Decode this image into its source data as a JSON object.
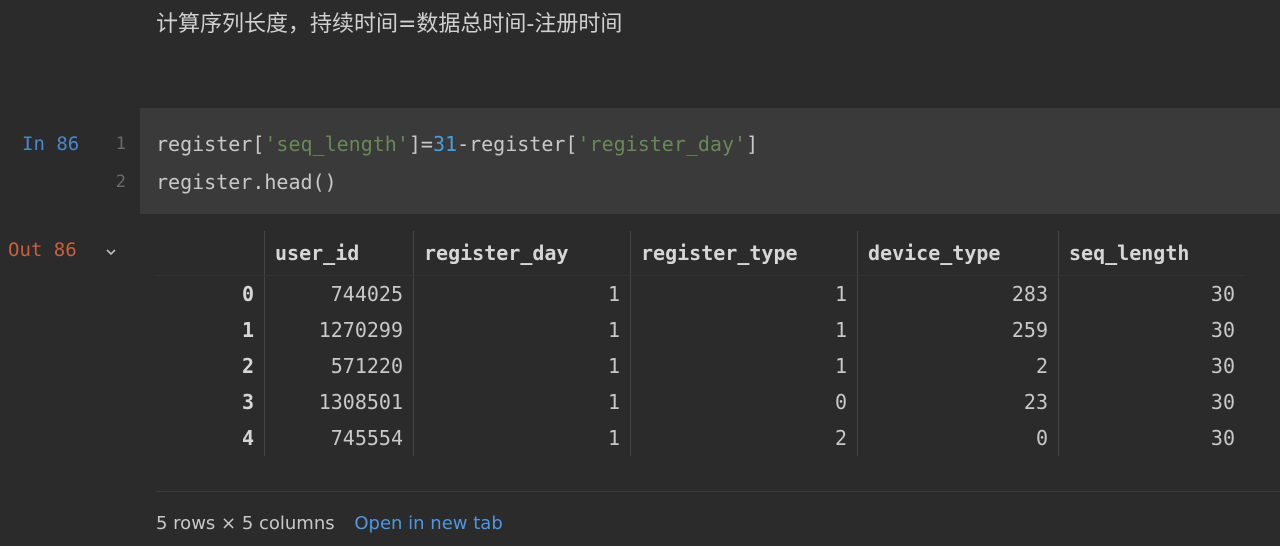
{
  "markdown": {
    "text": "计算序列长度，持续时间=数据总时间-注册时间"
  },
  "input_cell": {
    "prompt": "In 86",
    "lines": [
      {
        "number": "1",
        "tokens": [
          {
            "t": "register[",
            "k": "plain"
          },
          {
            "t": "'seq_length'",
            "k": "str"
          },
          {
            "t": "]=",
            "k": "plain"
          },
          {
            "t": "31",
            "k": "num"
          },
          {
            "t": "-register[",
            "k": "plain"
          },
          {
            "t": "'register_day'",
            "k": "str"
          },
          {
            "t": "]",
            "k": "plain"
          }
        ]
      },
      {
        "number": "2",
        "tokens": [
          {
            "t": "register.head()",
            "k": "plain"
          }
        ]
      }
    ]
  },
  "output_cell": {
    "prompt": "Out 86",
    "collapse_icon": "chevron-down-icon",
    "table": {
      "columns": [
        "user_id",
        "register_day",
        "register_type",
        "device_type",
        "seq_length"
      ],
      "index": [
        "0",
        "1",
        "2",
        "3",
        "4"
      ],
      "rows": [
        [
          "744025",
          "1",
          "1",
          "283",
          "30"
        ],
        [
          "1270299",
          "1",
          "1",
          "259",
          "30"
        ],
        [
          "571220",
          "1",
          "1",
          "2",
          "30"
        ],
        [
          "1308501",
          "1",
          "0",
          "23",
          "30"
        ],
        [
          "745554",
          "1",
          "2",
          "0",
          "30"
        ]
      ]
    },
    "footer": {
      "shape": "5 rows × 5 columns",
      "open_link": "Open in new tab"
    }
  },
  "colors": {
    "background": "#2b2b2b",
    "cell_background": "#3a3a3a",
    "prompt_in": "#4a88c7",
    "prompt_out": "#cc5f3b",
    "string": "#6a8759",
    "number": "#4a9fd8",
    "link": "#4f97e0"
  }
}
